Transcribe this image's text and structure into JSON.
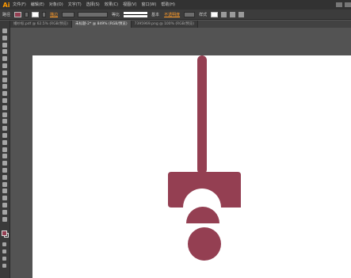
{
  "app": {
    "logo": "Ai"
  },
  "menu": {
    "items": [
      {
        "label": "文件(F)"
      },
      {
        "label": "编辑(E)"
      },
      {
        "label": "对象(O)"
      },
      {
        "label": "文字(T)"
      },
      {
        "label": "选择(S)"
      },
      {
        "label": "效果(C)"
      },
      {
        "label": "视图(V)"
      },
      {
        "label": "窗口(W)"
      },
      {
        "label": "帮助(H)"
      }
    ]
  },
  "control": {
    "mode_label": "路径",
    "stroke_label": "描边",
    "uniform_label": "等比",
    "basic_label": "基本",
    "opacity_label": "不透明度",
    "style_label": "样式",
    "fill_color": "#943f52",
    "stroke_color": "#ffffff"
  },
  "tabs": [
    {
      "label": "婚纱标.pdf @ 62.5% (RGB/预览)",
      "active": false
    },
    {
      "label": "未标题-2* @ 849% (RGB/预览)",
      "active": true
    },
    {
      "label": "7395969.png @ 100% (RGB/预览)",
      "active": false
    }
  ],
  "canvas": {
    "artwork_color": "#943f52",
    "background": "#ffffff"
  }
}
